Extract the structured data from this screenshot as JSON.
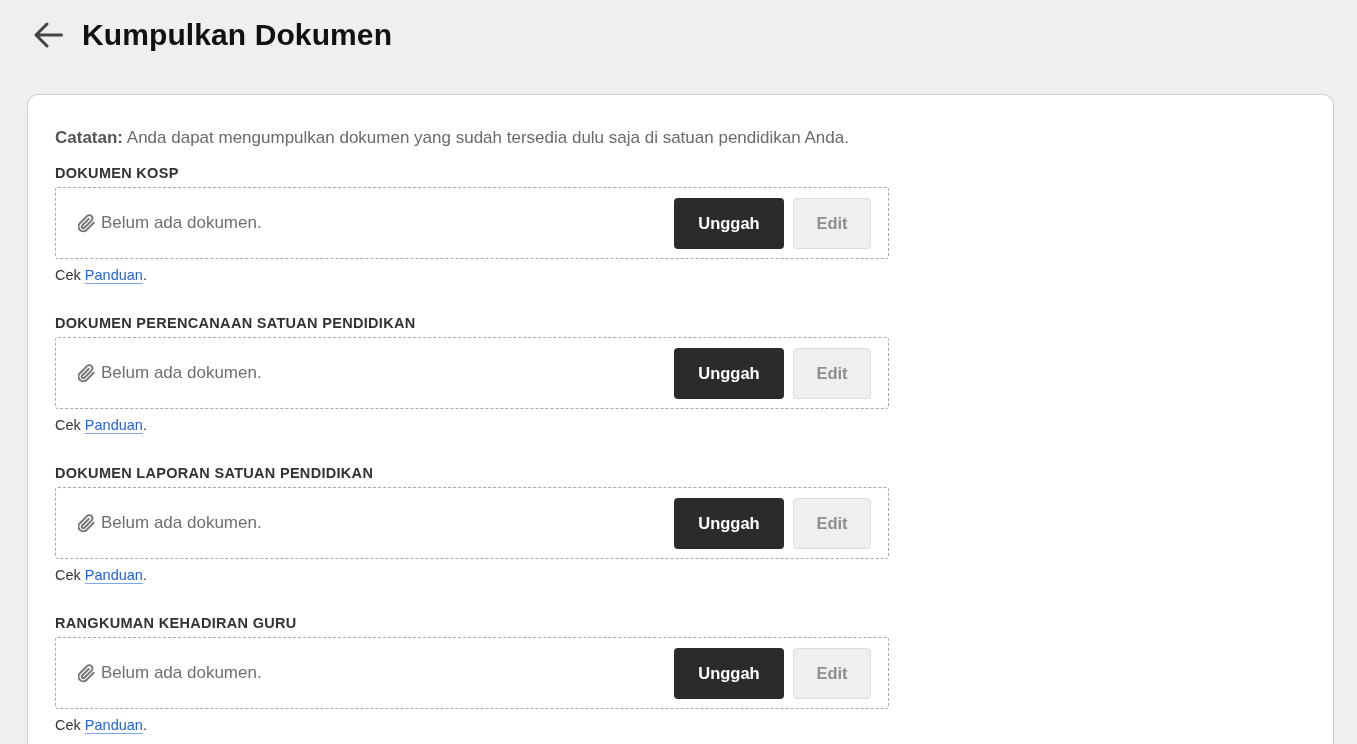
{
  "header": {
    "title": "Kumpulkan Dokumen"
  },
  "note": "**Catatan:** Anda dapat mengumpulkan dokumen yang sudah tersedia dulu saja di satuan pendidikan Anda.",
  "sections": [
    {
      "title": "DOKUMEN KOSP",
      "status": "Belum ada dokumen.",
      "upload_button": "Unggah",
      "edit_button": {
        "label": "Edit",
        "disabled": true
      },
      "help": {
        "prefix": "Cek",
        "link": "Panduan",
        "suffix": "."
      }
    },
    {
      "title": "DOKUMEN PERENCANAAN SATUAN PENDIDIKAN",
      "status": "Belum ada dokumen.",
      "upload_button": "Unggah",
      "edit_button": {
        "label": "Edit",
        "disabled": true
      },
      "help": {
        "prefix": "Cek",
        "link": "Panduan",
        "suffix": "."
      }
    },
    {
      "title": "DOKUMEN LAPORAN SATUAN PENDIDIKAN",
      "status": "Belum ada dokumen.",
      "upload_button": "Unggah",
      "edit_button": {
        "label": "Edit",
        "disabled": true
      },
      "help": {
        "prefix": "Cek",
        "link": "Panduan",
        "suffix": "."
      }
    },
    {
      "title": "RANGKUMAN KEHADIRAN GURU",
      "status": "Belum ada dokumen.",
      "upload_button": "Unggah",
      "edit_button": {
        "label": "Edit",
        "disabled": true
      },
      "help": {
        "prefix": "Cek",
        "link": "Panduan",
        "suffix": "."
      }
    }
  ]
}
